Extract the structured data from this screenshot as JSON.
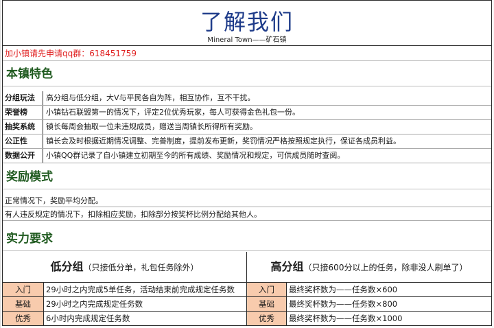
{
  "title": "了解我们",
  "subtitle": "Mineral Town——矿石镇",
  "join_notice": "加小镇请先申请qq群：618451759",
  "sections": {
    "features": "本镇特色",
    "rewards": "奖励模式",
    "requirements": "实力要求"
  },
  "features": [
    {
      "key": "分组玩法",
      "value": "高分组与低分组，大V与平民各自为阵，相互协作，互不干扰。"
    },
    {
      "key": "荣誉榜",
      "value": "小镇钻石联盟第一的情况下，评定2位优秀玩家，每人可获得金色礼包一份。"
    },
    {
      "key": "抽奖系统",
      "value": "镇长每周会抽取一位未违规成员，赠送当周镇长所得所有奖励。"
    },
    {
      "key": "公正性",
      "value": "镇长会及时根据近期情况调整、完善制度，提前发布更新，奖罚情况严格按照规定执行，保证各成员利益。"
    },
    {
      "key": "数据公开",
      "value": "小镇QQ群记录了自小镇建立初期至今的所有成绩、奖励情况和规定，可供成员随时查阅。"
    }
  ],
  "rewards": [
    "正常情况下，奖励平均分配。",
    "有人违反规定的情况下，扣除相应奖励，扣除部分按奖杯比例分配给其他人。"
  ],
  "groups": {
    "low": {
      "name": "低分组",
      "note": "（只接低分单，礼包任务除外）",
      "levels": [
        {
          "key": "入门",
          "value": "29小时之内完成5单任务，活动结束前完成规定任务数"
        },
        {
          "key": "基础",
          "value": "29小时之内完成规定任务数"
        },
        {
          "key": "优秀",
          "value": "6小时内完成规定任务数"
        }
      ]
    },
    "high": {
      "name": "高分组",
      "note": "（只接600分以上的任务，除非没人刷单了）",
      "levels": [
        {
          "key": "入门",
          "value": "最终奖杯数为——任务数×600"
        },
        {
          "key": "基础",
          "value": "最终奖杯数为——任务数×800"
        },
        {
          "key": "优秀",
          "value": "最终奖杯数为——任务数×1000"
        }
      ]
    }
  },
  "colors": {
    "title": "#1f3c8a",
    "section": "#1f5a1f",
    "notice": "#e02020",
    "level_key_bg": "#f8cbad"
  }
}
